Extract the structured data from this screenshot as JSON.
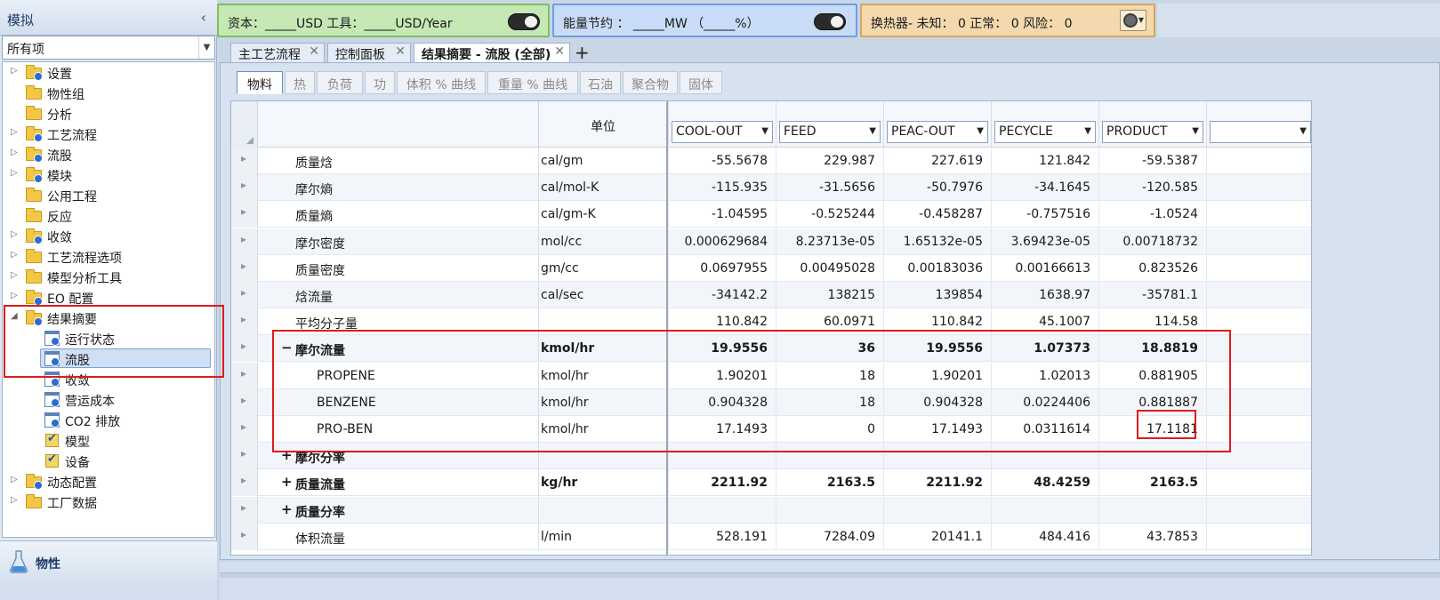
{
  "nav": {
    "title": "模拟",
    "filter_value": "所有项",
    "tree": [
      {
        "label": "设置",
        "expandable": true,
        "icon": "folder-check-icon",
        "level": 0
      },
      {
        "label": "物性组",
        "expandable": false,
        "icon": "folder-icon",
        "level": 0
      },
      {
        "label": "分析",
        "expandable": false,
        "icon": "folder-icon",
        "level": 0
      },
      {
        "label": "工艺流程",
        "expandable": true,
        "icon": "folder-check-icon",
        "level": 0
      },
      {
        "label": "流股",
        "expandable": true,
        "icon": "folder-check-icon",
        "level": 0
      },
      {
        "label": "模块",
        "expandable": true,
        "icon": "folder-check-icon",
        "level": 0
      },
      {
        "label": "公用工程",
        "expandable": false,
        "icon": "folder-icon",
        "level": 0
      },
      {
        "label": "反应",
        "expandable": false,
        "icon": "folder-icon",
        "level": 0
      },
      {
        "label": "收敛",
        "expandable": true,
        "icon": "folder-check-icon",
        "level": 0
      },
      {
        "label": "工艺流程选项",
        "expandable": true,
        "icon": "folder-icon",
        "level": 0
      },
      {
        "label": "模型分析工具",
        "expandable": true,
        "icon": "folder-icon",
        "level": 0
      },
      {
        "label": "EO 配置",
        "expandable": true,
        "icon": "folder-check-icon",
        "level": 0
      },
      {
        "label": "结果摘要",
        "expandable": true,
        "expanded": true,
        "icon": "folder-check-icon",
        "level": 0
      },
      {
        "label": "运行状态",
        "expandable": false,
        "icon": "doc-check-icon",
        "level": 1
      },
      {
        "label": "流股",
        "expandable": false,
        "icon": "doc-check-icon",
        "level": 1,
        "selected": true
      },
      {
        "label": "收敛",
        "expandable": false,
        "icon": "doc-check-icon",
        "level": 1
      },
      {
        "label": "营运成本",
        "expandable": false,
        "icon": "doc-check-icon",
        "level": 1
      },
      {
        "label": "CO2 排放",
        "expandable": false,
        "icon": "doc-check-icon",
        "level": 1
      },
      {
        "label": "模型",
        "expandable": false,
        "icon": "checkbox-icon",
        "level": 1
      },
      {
        "label": "设备",
        "expandable": false,
        "icon": "checkbox-icon",
        "level": 1
      },
      {
        "label": "动态配置",
        "expandable": true,
        "icon": "folder-check-icon",
        "level": 0
      },
      {
        "label": "工厂数据",
        "expandable": true,
        "icon": "folder-icon",
        "level": 0
      }
    ],
    "bottom_label": "物性"
  },
  "status": {
    "capital_text": "资本：_____USD   工具：_____USD/Year",
    "energy_text": "能量节约 ： _____MW   （_____%）",
    "hx_text": "换热器-  未知： 0    正常：  0    风险：  0"
  },
  "doc_tabs": [
    {
      "label": "主工艺流程",
      "active": false
    },
    {
      "label": "控制面板",
      "active": false
    },
    {
      "label": "结果摘要 - 流股 (全部)",
      "active": true
    }
  ],
  "sub_tabs": [
    "物料",
    "热",
    "负荷",
    "功",
    "体积 % 曲线",
    "重量 % 曲线",
    "石油",
    "聚合物",
    "固体"
  ],
  "grid": {
    "unit_header": "单位",
    "columns": [
      "COOL-OUT",
      "FEED",
      "PEAC-OUT",
      "PECYCLE",
      "PRODUCT",
      ""
    ],
    "rows": [
      {
        "name": "质量焓",
        "unit": "cal/gm",
        "values": [
          "-55.5678",
          "229.987",
          "227.619",
          "121.842",
          "-59.5387"
        ],
        "indent": 1,
        "bold": false,
        "exp": ""
      },
      {
        "name": "摩尔熵",
        "unit": "cal/mol-K",
        "values": [
          "-115.935",
          "-31.5656",
          "-50.7976",
          "-34.1645",
          "-120.585"
        ],
        "indent": 1,
        "bold": false,
        "exp": ""
      },
      {
        "name": "质量熵",
        "unit": "cal/gm-K",
        "values": [
          "-1.04595",
          "-0.525244",
          "-0.458287",
          "-0.757516",
          "-1.0524"
        ],
        "indent": 1,
        "bold": false,
        "exp": ""
      },
      {
        "name": "摩尔密度",
        "unit": "mol/cc",
        "values": [
          "0.000629684",
          "8.23713e-05",
          "1.65132e-05",
          "3.69423e-05",
          "0.00718732"
        ],
        "indent": 1,
        "bold": false,
        "exp": ""
      },
      {
        "name": "质量密度",
        "unit": "gm/cc",
        "values": [
          "0.0697955",
          "0.00495028",
          "0.00183036",
          "0.00166613",
          "0.823526"
        ],
        "indent": 1,
        "bold": false,
        "exp": ""
      },
      {
        "name": "焓流量",
        "unit": "cal/sec",
        "values": [
          "-34142.2",
          "138215",
          "139854",
          "1638.97",
          "-35781.1"
        ],
        "indent": 1,
        "bold": false,
        "exp": ""
      },
      {
        "name": "平均分子量",
        "unit": "",
        "values": [
          "110.842",
          "60.0971",
          "110.842",
          "45.1007",
          "114.58"
        ],
        "indent": 1,
        "bold": false,
        "exp": ""
      },
      {
        "name": "摩尔流量",
        "unit": "kmol/hr",
        "values": [
          "19.9556",
          "36",
          "19.9556",
          "1.07373",
          "18.8819"
        ],
        "indent": 1,
        "bold": true,
        "exp": "−"
      },
      {
        "name": "PROPENE",
        "unit": "kmol/hr",
        "values": [
          "1.90201",
          "18",
          "1.90201",
          "1.02013",
          "0.881905"
        ],
        "indent": 2,
        "bold": false,
        "exp": ""
      },
      {
        "name": "BENZENE",
        "unit": "kmol/hr",
        "values": [
          "0.904328",
          "18",
          "0.904328",
          "0.0224406",
          "0.881887"
        ],
        "indent": 2,
        "bold": false,
        "exp": ""
      },
      {
        "name": "PRO-BEN",
        "unit": "kmol/hr",
        "values": [
          "17.1493",
          "0",
          "17.1493",
          "0.0311614",
          "17.1181"
        ],
        "indent": 2,
        "bold": false,
        "exp": ""
      },
      {
        "name": "摩尔分率",
        "unit": "",
        "values": [
          "",
          "",
          "",
          "",
          ""
        ],
        "indent": 1,
        "bold": true,
        "exp": "+"
      },
      {
        "name": "质量流量",
        "unit": "kg/hr",
        "values": [
          "2211.92",
          "2163.5",
          "2211.92",
          "48.4259",
          "2163.5"
        ],
        "indent": 1,
        "bold": true,
        "exp": "+"
      },
      {
        "name": "质量分率",
        "unit": "",
        "values": [
          "",
          "",
          "",
          "",
          ""
        ],
        "indent": 1,
        "bold": true,
        "exp": "+"
      },
      {
        "name": "体积流量",
        "unit": "l/min",
        "values": [
          "528.191",
          "7284.09",
          "20141.1",
          "484.416",
          "43.7853"
        ],
        "indent": 1,
        "bold": false,
        "exp": ""
      }
    ]
  },
  "colors": {
    "annotation_red": "#e01b1b",
    "capital_bar": "#c6e8b5",
    "energy_bar": "#c8dcf7",
    "hx_bar": "#f3d9ad"
  }
}
